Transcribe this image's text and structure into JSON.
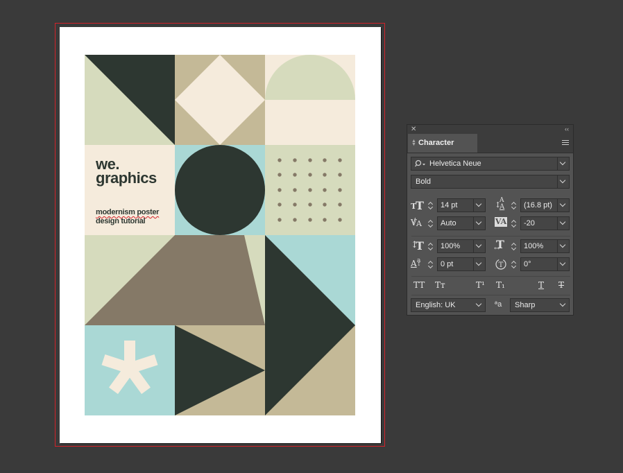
{
  "poster": {
    "title_line1": "we.",
    "title_line2": "graphics",
    "subtitle_line1": "modernism poster",
    "subtitle_line2": "design tutorial",
    "colors": {
      "dark": "#2d3731",
      "sage": "#d6dbbd",
      "cream": "#f5ebdc",
      "tan": "#c4b997",
      "brown": "#857967",
      "aqua": "#aad8d5",
      "bleed_guide": "#d2232a"
    }
  },
  "panel": {
    "title": "Character",
    "font_family": "Helvetica Neue",
    "font_style": "Bold",
    "font_size": "14 pt",
    "leading": "(16.8 pt)",
    "kerning": "Auto",
    "tracking": "-20",
    "vertical_scale": "100%",
    "horizontal_scale": "100%",
    "baseline_shift": "0 pt",
    "rotation": "0°",
    "language": "English: UK",
    "antialiasing": "Sharp",
    "aa_label": "ªa",
    "icons": {
      "search": "search-icon",
      "close": "close-icon",
      "collapse": "collapse-icon",
      "menu": "menu-icon"
    },
    "type_buttons": {
      "all_caps": "TT",
      "small_caps": "Tт",
      "superscript": "T¹",
      "subscript": "T₁",
      "underline": "T",
      "strikethrough": "T"
    }
  }
}
